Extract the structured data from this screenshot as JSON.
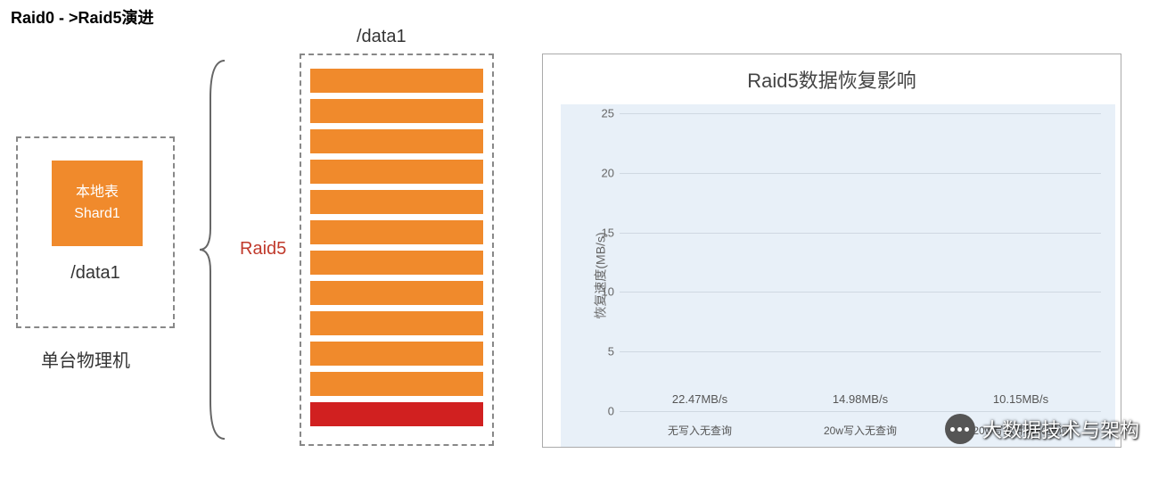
{
  "title": "Raid0 - >Raid5演进",
  "diagram": {
    "data1_label": "/data1",
    "shard_line1": "本地表",
    "shard_line2": "Shard1",
    "data1_small": "/data1",
    "server_caption": "单台物理机",
    "raid5_label": "Raid5",
    "disk_count": 12
  },
  "chart_data": {
    "type": "bar",
    "title": "Raid5数据恢复影响",
    "ylabel": "恢复速度(MB/s)",
    "ylim": [
      0,
      25
    ],
    "yticks": [
      0,
      5,
      10,
      15,
      20,
      25
    ],
    "categories": [
      "无写入无查询",
      "20w写入无查询",
      "20w写入并发50查询"
    ],
    "values": [
      22.47,
      14.98,
      10.15
    ],
    "value_labels": [
      "22.47MB/s",
      "14.98MB/s",
      "10.15MB/s"
    ],
    "bar_color": "#9cc3e4"
  },
  "watermark": "大数据技术与架构"
}
